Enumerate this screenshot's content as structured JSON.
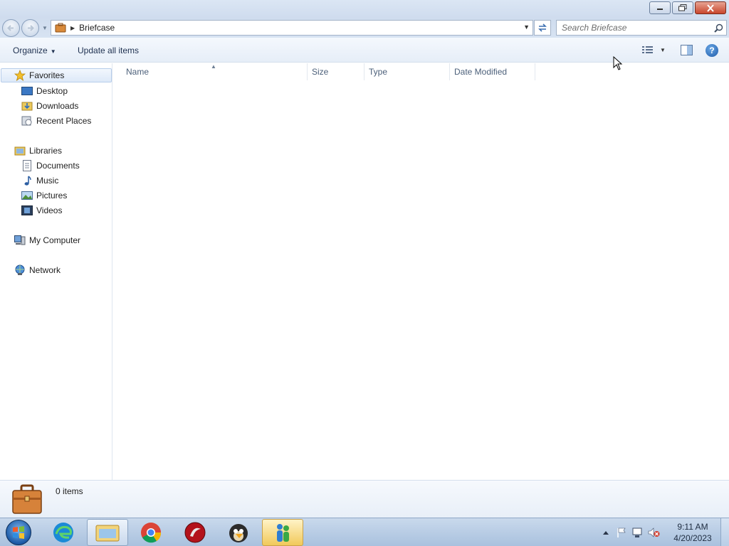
{
  "window": {
    "address": {
      "crumb": "Briefcase"
    },
    "search": {
      "placeholder": "Search Briefcase"
    }
  },
  "toolbar": {
    "organize_label": "Organize",
    "update_label": "Update all items"
  },
  "nav": {
    "favorites": {
      "label": "Favorites",
      "items": [
        {
          "label": "Desktop"
        },
        {
          "label": "Downloads"
        },
        {
          "label": "Recent Places"
        }
      ]
    },
    "libraries": {
      "label": "Libraries",
      "items": [
        {
          "label": "Documents"
        },
        {
          "label": "Music"
        },
        {
          "label": "Pictures"
        },
        {
          "label": "Videos"
        }
      ]
    },
    "computer": {
      "label": "My Computer"
    },
    "network": {
      "label": "Network"
    }
  },
  "columns": [
    "Name",
    "Size",
    "Type",
    "Date Modified"
  ],
  "status": {
    "count": "0 items"
  },
  "taskbar": {
    "apps": [
      "start-menu",
      "edge",
      "file-explorer",
      "chrome",
      "app-red",
      "app-bird",
      "app-people"
    ],
    "clock": {
      "time": "9:11 AM",
      "date": "4/20/2023"
    }
  },
  "colors": {
    "titlebar": "#cfdcee",
    "close_button": "#c8452c",
    "taskbar": "#a9c1de",
    "nav_selected": "#dde9f8"
  }
}
